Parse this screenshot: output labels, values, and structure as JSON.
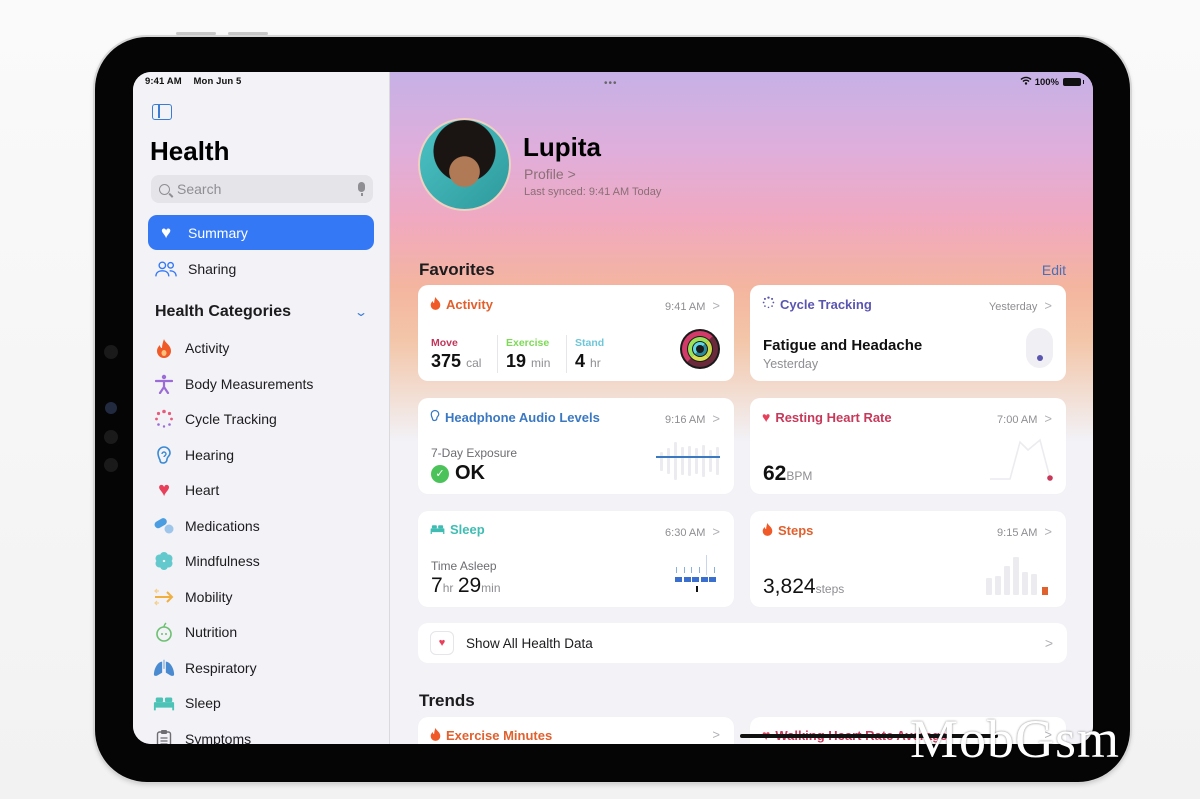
{
  "status_bar": {
    "time": "9:41 AM",
    "date": "Mon Jun 5",
    "battery": "100%",
    "multitask_dots": "•••"
  },
  "sidebar": {
    "title": "Health",
    "search": {
      "placeholder": "Search",
      "value": ""
    },
    "nav": [
      {
        "label": "Summary",
        "icon": "heart-icon",
        "active": true
      },
      {
        "label": "Sharing",
        "icon": "people-icon",
        "active": false
      }
    ],
    "categories_title": "Health Categories",
    "categories": [
      {
        "label": "Activity",
        "icon": "flame-icon",
        "color": "#f05a28"
      },
      {
        "label": "Body Measurements",
        "icon": "figure-icon",
        "color": "#9b6bd6"
      },
      {
        "label": "Cycle Tracking",
        "icon": "cycle-dots-icon",
        "color": "#e75b7b"
      },
      {
        "label": "Hearing",
        "icon": "ear-icon",
        "color": "#3a8ad6"
      },
      {
        "label": "Heart",
        "icon": "heart-icon",
        "color": "#e8405a"
      },
      {
        "label": "Medications",
        "icon": "pills-icon",
        "color": "#4a9de0"
      },
      {
        "label": "Mindfulness",
        "icon": "flower-icon",
        "color": "#4cc3c6"
      },
      {
        "label": "Mobility",
        "icon": "arrows-icon",
        "color": "#f0b040"
      },
      {
        "label": "Nutrition",
        "icon": "apple-icon",
        "color": "#6cc070"
      },
      {
        "label": "Respiratory",
        "icon": "lungs-icon",
        "color": "#4a8ad0"
      },
      {
        "label": "Sleep",
        "icon": "bed-icon",
        "color": "#4cc3b6"
      },
      {
        "label": "Symptoms",
        "icon": "clipboard-icon",
        "color": "#6d6d72"
      }
    ]
  },
  "profile": {
    "name": "Lupita",
    "link": "Profile",
    "synced": "Last synced: 9:41 AM Today"
  },
  "favorites": {
    "title": "Favorites",
    "edit": "Edit",
    "activity": {
      "title": "Activity",
      "time": "9:41 AM",
      "color": "#e0602e",
      "metrics": [
        {
          "label": "Move",
          "value": "375",
          "unit": "cal",
          "color": "#c0365a"
        },
        {
          "label": "Exercise",
          "value": "19",
          "unit": "min",
          "color": "#7ed957"
        },
        {
          "label": "Stand",
          "value": "4",
          "unit": "hr",
          "color": "#6fc6d8"
        }
      ]
    },
    "cycle": {
      "title": "Cycle Tracking",
      "time": "Yesterday",
      "headline": "Fatigue and Headache",
      "sub": "Yesterday",
      "color": "#5a55b0"
    },
    "headphone": {
      "title": "Headphone Audio Levels",
      "time": "9:16 AM",
      "label": "7-Day Exposure",
      "value": "OK",
      "color": "#3a78c2"
    },
    "heart_rate": {
      "title": "Resting Heart Rate",
      "time": "7:00 AM",
      "value": "62",
      "unit": "BPM",
      "color": "#c7395a"
    },
    "sleep": {
      "title": "Sleep",
      "time": "6:30 AM",
      "label": "Time Asleep",
      "hours": "7",
      "hours_unit": "hr",
      "minutes": "29",
      "minutes_unit": "min",
      "color": "#3fbdb3"
    },
    "steps": {
      "title": "Steps",
      "time": "9:15 AM",
      "value": "3,824",
      "unit": "steps",
      "color": "#e0602e"
    }
  },
  "show_all": "Show All Health Data",
  "trends": {
    "title": "Trends",
    "items": [
      {
        "title": "Exercise Minutes",
        "color": "#e0602e"
      },
      {
        "title": "Walking Heart Rate Average",
        "color": "#c7395a"
      }
    ]
  },
  "watermark": "MobGsm"
}
